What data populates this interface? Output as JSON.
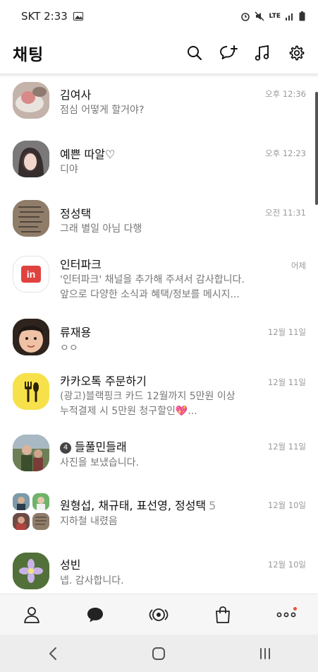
{
  "status_bar": {
    "carrier_time": "SKT 2:33",
    "network": "LTE"
  },
  "header": {
    "title": "채팅"
  },
  "chats": [
    {
      "name": "김여사",
      "message": "점심 어떻게 할거야?",
      "time": "오후 12:36"
    },
    {
      "name": "예쁜 따알♡",
      "message": "디야",
      "time": "오후 12:23"
    },
    {
      "name": "정성택",
      "message": "그래 별일 아님 다행",
      "time": "오전 11:31"
    },
    {
      "name": "인터파크",
      "message": "'인터파크' 채널을 추가해 주셔서 감사합니다.",
      "message2": "앞으로 다양한 소식과 혜택/정보를 메시지...",
      "time": "어제"
    },
    {
      "name": "류재용",
      "message": "ㅇㅇ",
      "time": "12월 11일"
    },
    {
      "name": "카카오톡 주문하기",
      "message": "(광고)블랙핑크 카드 12월까지 5만원 이상",
      "message2": "누적결제 시 5만원 청구할인💖...",
      "time": "12월 11일"
    },
    {
      "name": "들풀민들래",
      "badge": "4",
      "message": "사진을 보냈습니다.",
      "time": "12월 11일"
    },
    {
      "name": "원형섭, 채규태, 표선영, 정성택",
      "count": "5",
      "message": "지하철 내렸음",
      "time": "12월 10일"
    },
    {
      "name": "성빈",
      "message": "넵. 감사합니다.",
      "time": "12월 10일"
    }
  ],
  "colors": {
    "interpark_red": "#e0423f",
    "kakao_order_yellow": "#f7e14b",
    "notification_dot": "#e8523f"
  }
}
